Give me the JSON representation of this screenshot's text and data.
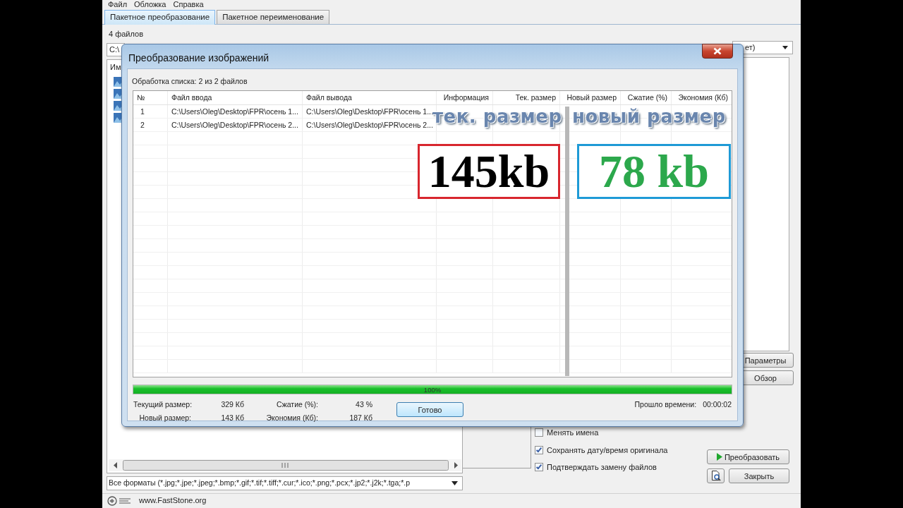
{
  "app": {
    "menu": [
      "Файл",
      "Обложка",
      "Справка"
    ],
    "tabs": [
      {
        "label": "Пакетное преобразование",
        "selected": true
      },
      {
        "label": "Пакетное переименование",
        "selected": false
      }
    ],
    "file_count": "4 файлов",
    "path_field": "C:\\",
    "list_header": "Им",
    "output_format": "ет)",
    "side_buttons": [
      "Параметры",
      "Обзор"
    ],
    "options": [
      {
        "label": "Менять имена",
        "checked": false
      },
      {
        "label": "Сохранять дату/время оригинала",
        "checked": true
      },
      {
        "label": "Подтверждать замену файлов",
        "checked": true
      }
    ],
    "convert_button": "Преобразовать",
    "close_button": "Закрыть",
    "format_filter": "Все форматы (*.jpg;*.jpe;*.jpeg;*.bmp;*.gif;*.tif;*.tiff;*.cur;*.ico;*.png;*.pcx;*.jp2;*.j2k;*.tga;*.p",
    "website": "www.FastStone.org"
  },
  "dialog": {
    "title": "Преобразование изображений",
    "status": "Обработка списка: 2 из 2 файлов",
    "columns": [
      "№",
      "Файл ввода",
      "Файл вывода",
      "Информация",
      "Тек. размер",
      "Новый размер",
      "Сжатие (%)",
      "Экономия (Кб)"
    ],
    "rows": [
      {
        "cells": [
          "1",
          "C:\\Users\\Oleg\\Desktop\\FPR\\осень 1...",
          "C:\\Users\\Oleg\\Desktop\\FPR\\осень 1..."
        ]
      },
      {
        "cells": [
          "2",
          "C:\\Users\\Oleg\\Desktop\\FPR\\осень 2...",
          "C:\\Users\\Oleg\\Desktop\\FPR\\осень 2..."
        ]
      }
    ],
    "progress": {
      "level": 1,
      "label": "100%"
    },
    "stats": [
      {
        "label": "Текущий размер:",
        "value": "329 Кб"
      },
      {
        "label": "Сжатие (%):",
        "value": "43 %"
      },
      {
        "label": "Новый размер:",
        "value": "143 Кб"
      },
      {
        "label": "Экономия (Кб):",
        "value": "187 Кб"
      }
    ],
    "done_button": "Готово",
    "elapsed_label": "Прошло времени:",
    "elapsed_value": "00:00:02"
  },
  "annotations": [
    {
      "kind": "caption",
      "text": "тек. размер"
    },
    {
      "kind": "caption",
      "text": "новый размер"
    },
    {
      "kind": "boxed",
      "text": "145kb",
      "color": "#000000",
      "frame": {
        "color": "#d8262e"
      }
    },
    {
      "kind": "boxed",
      "text": "78 kb",
      "color": "#2ca84c",
      "frame": {
        "color": "#1e9ad6"
      }
    }
  ]
}
